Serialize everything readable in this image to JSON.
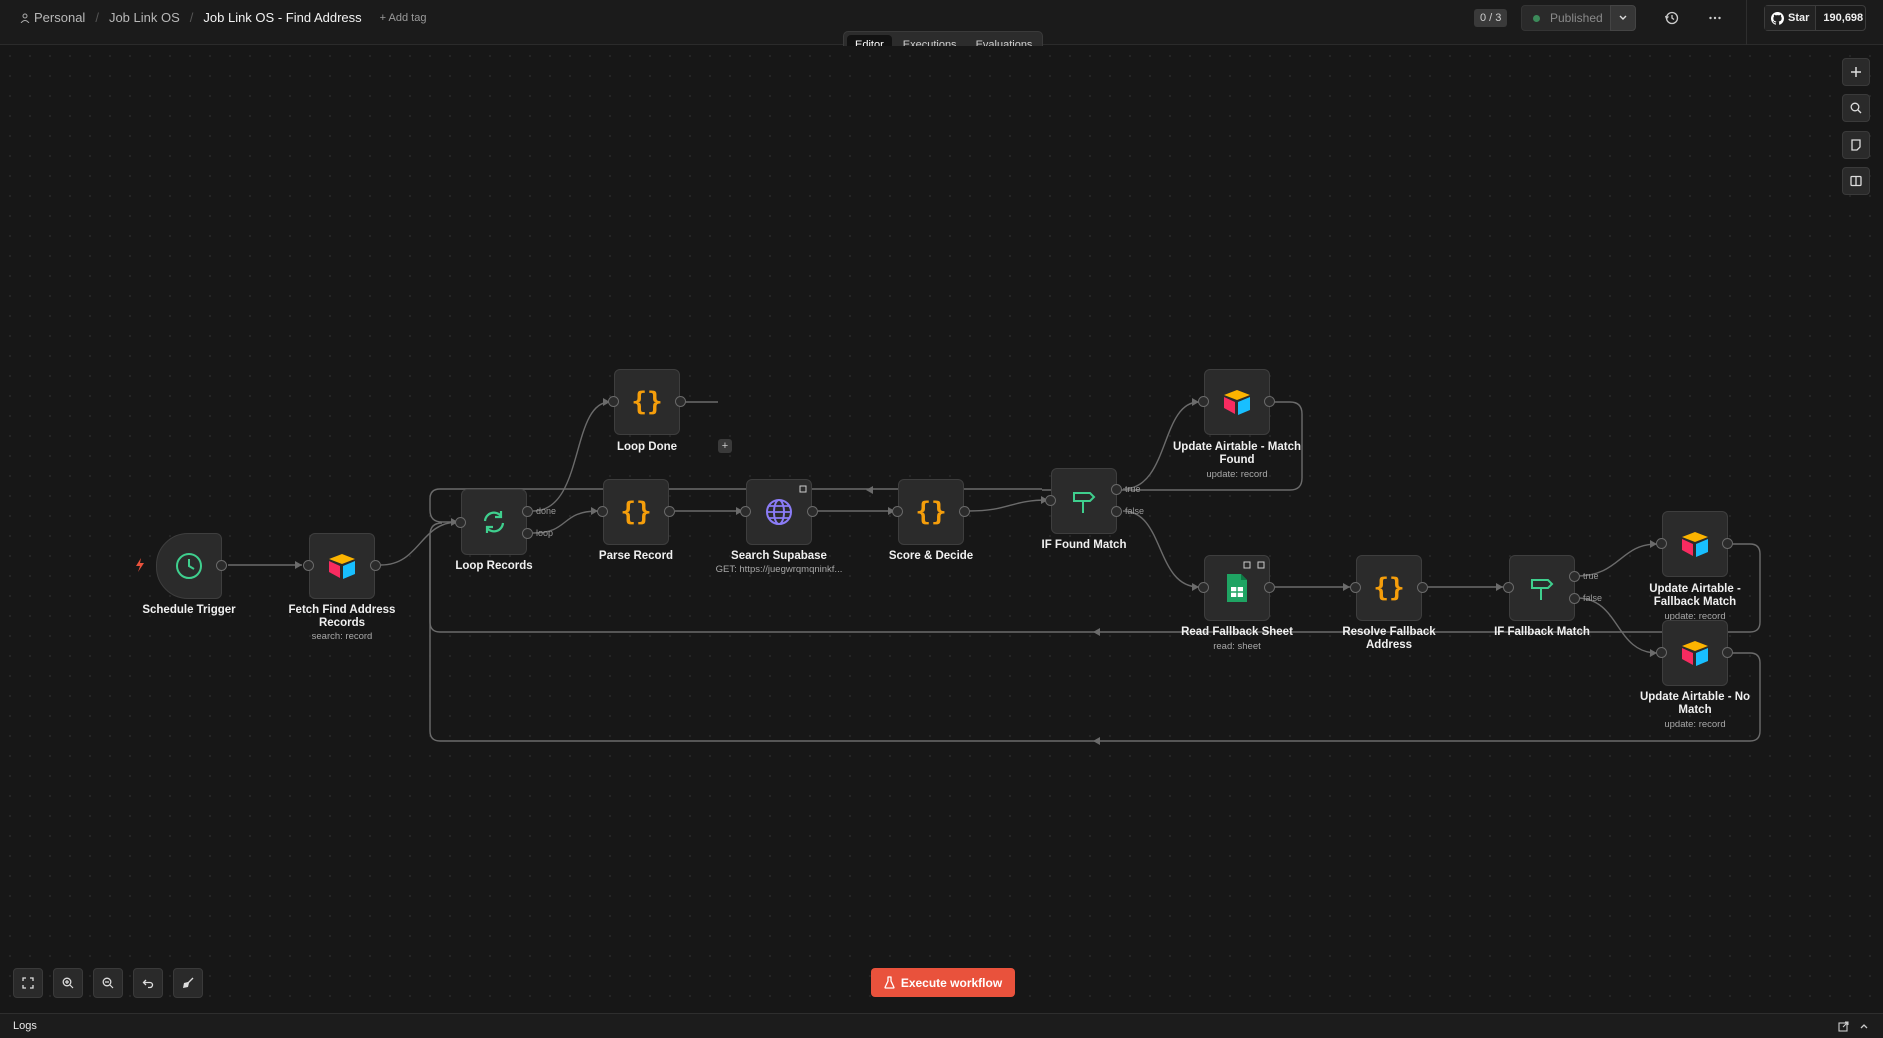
{
  "breadcrumb": {
    "personal": "Personal",
    "project": "Job Link OS",
    "workflow": "Job Link OS - Find Address",
    "add_tag": "+ Add tag"
  },
  "header": {
    "counter": "0 / 3",
    "published": "Published",
    "github_star": "Star",
    "github_count": "190,698"
  },
  "tabs": [
    "Editor",
    "Executions",
    "Evaluations"
  ],
  "nodes": {
    "schedule": {
      "label": "Schedule Trigger"
    },
    "fetch": {
      "label": "Fetch Find Address Records",
      "sub": "search: record"
    },
    "loop": {
      "label": "Loop Records"
    },
    "loop_done": {
      "label": "Loop Done"
    },
    "parse": {
      "label": "Parse Record"
    },
    "search": {
      "label": "Search Supabase",
      "sub": "GET: https://juegwrqmqninkf..."
    },
    "score": {
      "label": "Score & Decide"
    },
    "if_found": {
      "label": "IF Found Match"
    },
    "update_found": {
      "label": "Update Airtable - Match Found",
      "sub": "update: record"
    },
    "read_fallback": {
      "label": "Read Fallback Sheet",
      "sub": "read: sheet"
    },
    "resolve": {
      "label": "Resolve Fallback Address"
    },
    "if_fallback": {
      "label": "IF Fallback Match"
    },
    "update_fallback": {
      "label": "Update Airtable - Fallback Match",
      "sub": "update: record"
    },
    "update_nomatch": {
      "label": "Update Airtable - No Match",
      "sub": "update: record"
    }
  },
  "branches": {
    "done": "done",
    "loop": "loop",
    "true": "true",
    "false": "false"
  },
  "execute": "Execute workflow",
  "logs": "Logs",
  "colors": {
    "accent": "#e9523c",
    "code": "#f59e0b",
    "router": "#3fcf8e",
    "http": "#8b7cf6"
  }
}
